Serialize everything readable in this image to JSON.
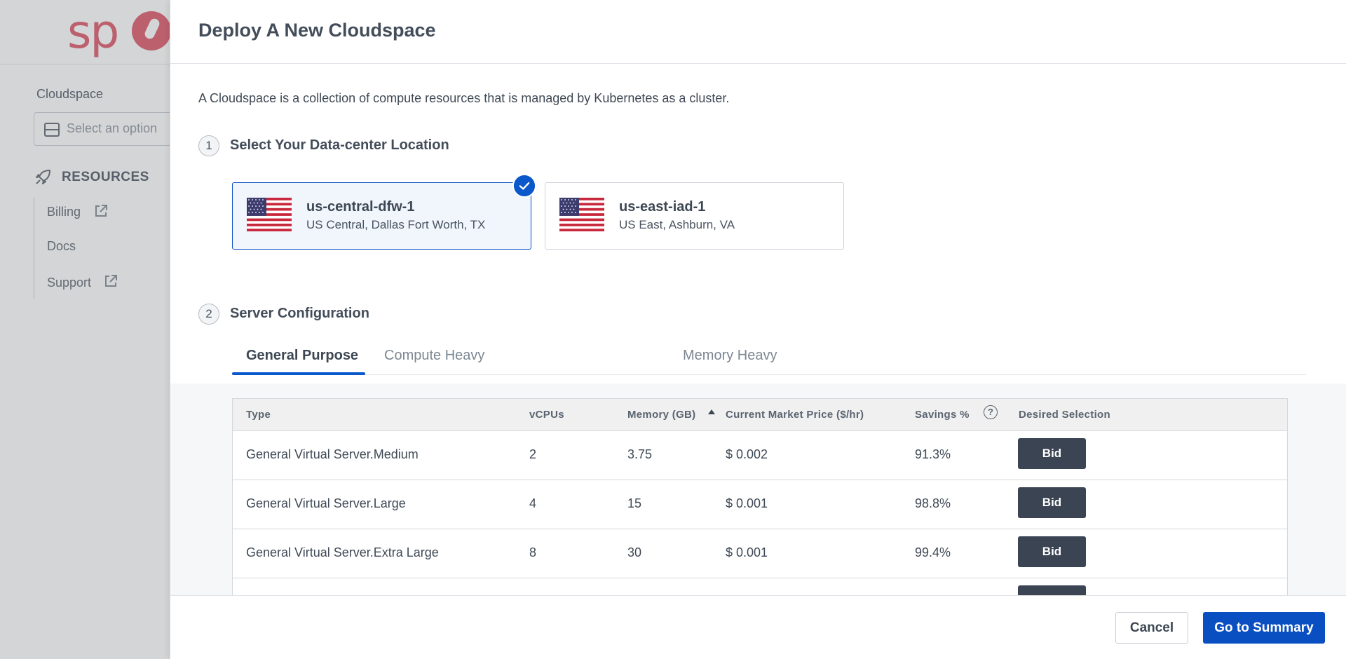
{
  "background": {
    "logo_text": "sp",
    "cloudspace_label": "Cloudspace",
    "select_placeholder": "Select an option",
    "resources_label": "RESOURCES",
    "nav": [
      {
        "label": "Billing"
      },
      {
        "label": "Docs"
      },
      {
        "label": "Support"
      }
    ]
  },
  "modal": {
    "title": "Deploy A New Cloudspace",
    "intro": "A Cloudspace is a collection of compute resources that is managed by Kubernetes as a cluster.",
    "step1": {
      "num": "1",
      "label": "Select Your Data-center Location"
    },
    "locations": [
      {
        "name": "us-central-dfw-1",
        "desc": "US Central, Dallas Fort Worth, TX",
        "selected": true
      },
      {
        "name": "us-east-iad-1",
        "desc": "US East, Ashburn, VA",
        "selected": false
      }
    ],
    "step2": {
      "num": "2",
      "label": "Server Configuration"
    },
    "tabs": [
      {
        "label": "General Purpose",
        "active": true
      },
      {
        "label": "Compute Heavy",
        "active": false
      },
      {
        "label": "Memory Heavy",
        "active": false
      }
    ],
    "table": {
      "headers": {
        "type": "Type",
        "vcpus": "vCPUs",
        "memory": "Memory (GB)",
        "price": "Current Market Price ($/hr)",
        "savings": "Savings %",
        "selection": "Desired Selection"
      },
      "help_glyph": "?",
      "rows": [
        {
          "type": "General Virtual Server.Medium",
          "vcpus": "2",
          "memory": "3.75",
          "price": "$ 0.002",
          "savings": "91.3%",
          "action": "Bid"
        },
        {
          "type": "General Virtual Server.Large",
          "vcpus": "4",
          "memory": "15",
          "price": "$ 0.001",
          "savings": "98.8%",
          "action": "Bid"
        },
        {
          "type": "General Virtual Server.Extra Large",
          "vcpus": "8",
          "memory": "30",
          "price": "$ 0.001",
          "savings": "99.4%",
          "action": "Bid"
        }
      ]
    },
    "footer": {
      "cancel_label": "Cancel",
      "primary_label": "Go to Summary"
    }
  },
  "colors": {
    "accent": "#0a58ca",
    "primary_button": "#0a4fc2",
    "bid_button": "#3a4452",
    "brand_logo": "#e0697a"
  },
  "icons": {
    "check": "check-icon",
    "help": "question-circle-icon",
    "external": "external-link-icon",
    "rocket": "rocket-icon",
    "server": "server-icon",
    "flag": "us-flag-icon"
  }
}
